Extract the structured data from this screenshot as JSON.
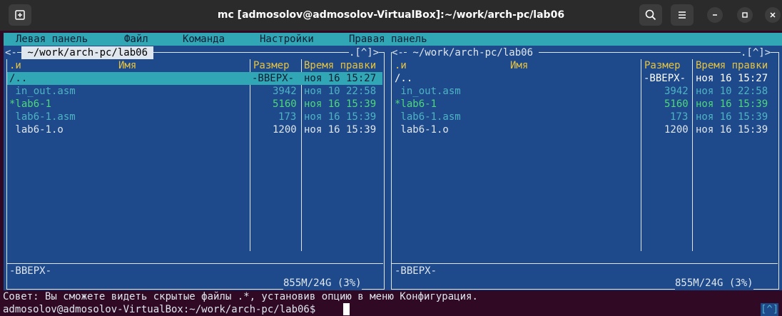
{
  "window": {
    "title": "mc [admosolov@admosolov-VirtualBox]:~/work/arch-pc/lab06"
  },
  "menu": [
    "Левая панель",
    "Файл",
    "Команда",
    "Настройки",
    "Правая панель"
  ],
  "left_panel": {
    "path": " ~/work/arch-pc/lab06 ",
    "corner": ".[^]>",
    "col_sort": ".и",
    "col_name": "Имя",
    "col_size": "Размер",
    "col_time": "Время правки",
    "files": [
      {
        "name": "/..",
        "size": "-ВВЕРХ-",
        "time": "ноя 16 15:27"
      },
      {
        "name": " in_out.asm",
        "size": "3942",
        "time": "ноя 10 22:58"
      },
      {
        "name": "*lab6-1",
        "size": "5160",
        "time": "ноя 16 15:39"
      },
      {
        "name": " lab6-1.asm",
        "size": "173",
        "time": "ноя 16 15:39"
      },
      {
        "name": " lab6-1.o",
        "size": "1200",
        "time": "ноя 16 15:39"
      }
    ],
    "status": "-ВВЕРХ-",
    "disk": "855M/24G (3%)"
  },
  "right_panel": {
    "path": " ~/work/arch-pc/lab06 ",
    "corner": ".[^]>",
    "col_sort": ".и",
    "col_name": "Имя",
    "col_size": "Размер",
    "col_time": "Время правки",
    "files": [
      {
        "name": "/..",
        "size": "-ВВЕРХ-",
        "time": "ноя 16 15:27"
      },
      {
        "name": " in_out.asm",
        "size": "3942",
        "time": "ноя 10 22:58"
      },
      {
        "name": "*lab6-1",
        "size": "5160",
        "time": "ноя 16 15:39"
      },
      {
        "name": " lab6-1.asm",
        "size": "173",
        "time": "ноя 16 15:39"
      },
      {
        "name": " lab6-1.o",
        "size": "1200",
        "time": "ноя 16 15:39"
      }
    ],
    "status": "-ВВЕРХ-",
    "disk": "855M/24G (3%)"
  },
  "hint": "Совет: Вы сможете видеть скрытые файлы .*, установив опцию в меню Конфигурация.",
  "prompt": "admosolov@admosolov-VirtualBox:~/work/arch-pc/lab06$",
  "scroll_indicator": "[^]",
  "colors": {
    "panel": "#1e4a8b",
    "menubar": "#31a6b5",
    "terminal_bg": "#300a24",
    "titlebar": "#2b2b2b"
  },
  "icons": [
    "new-tab-icon",
    "search-icon",
    "hamburger-menu-icon",
    "minimize-icon",
    "maximize-icon",
    "close-icon"
  ]
}
